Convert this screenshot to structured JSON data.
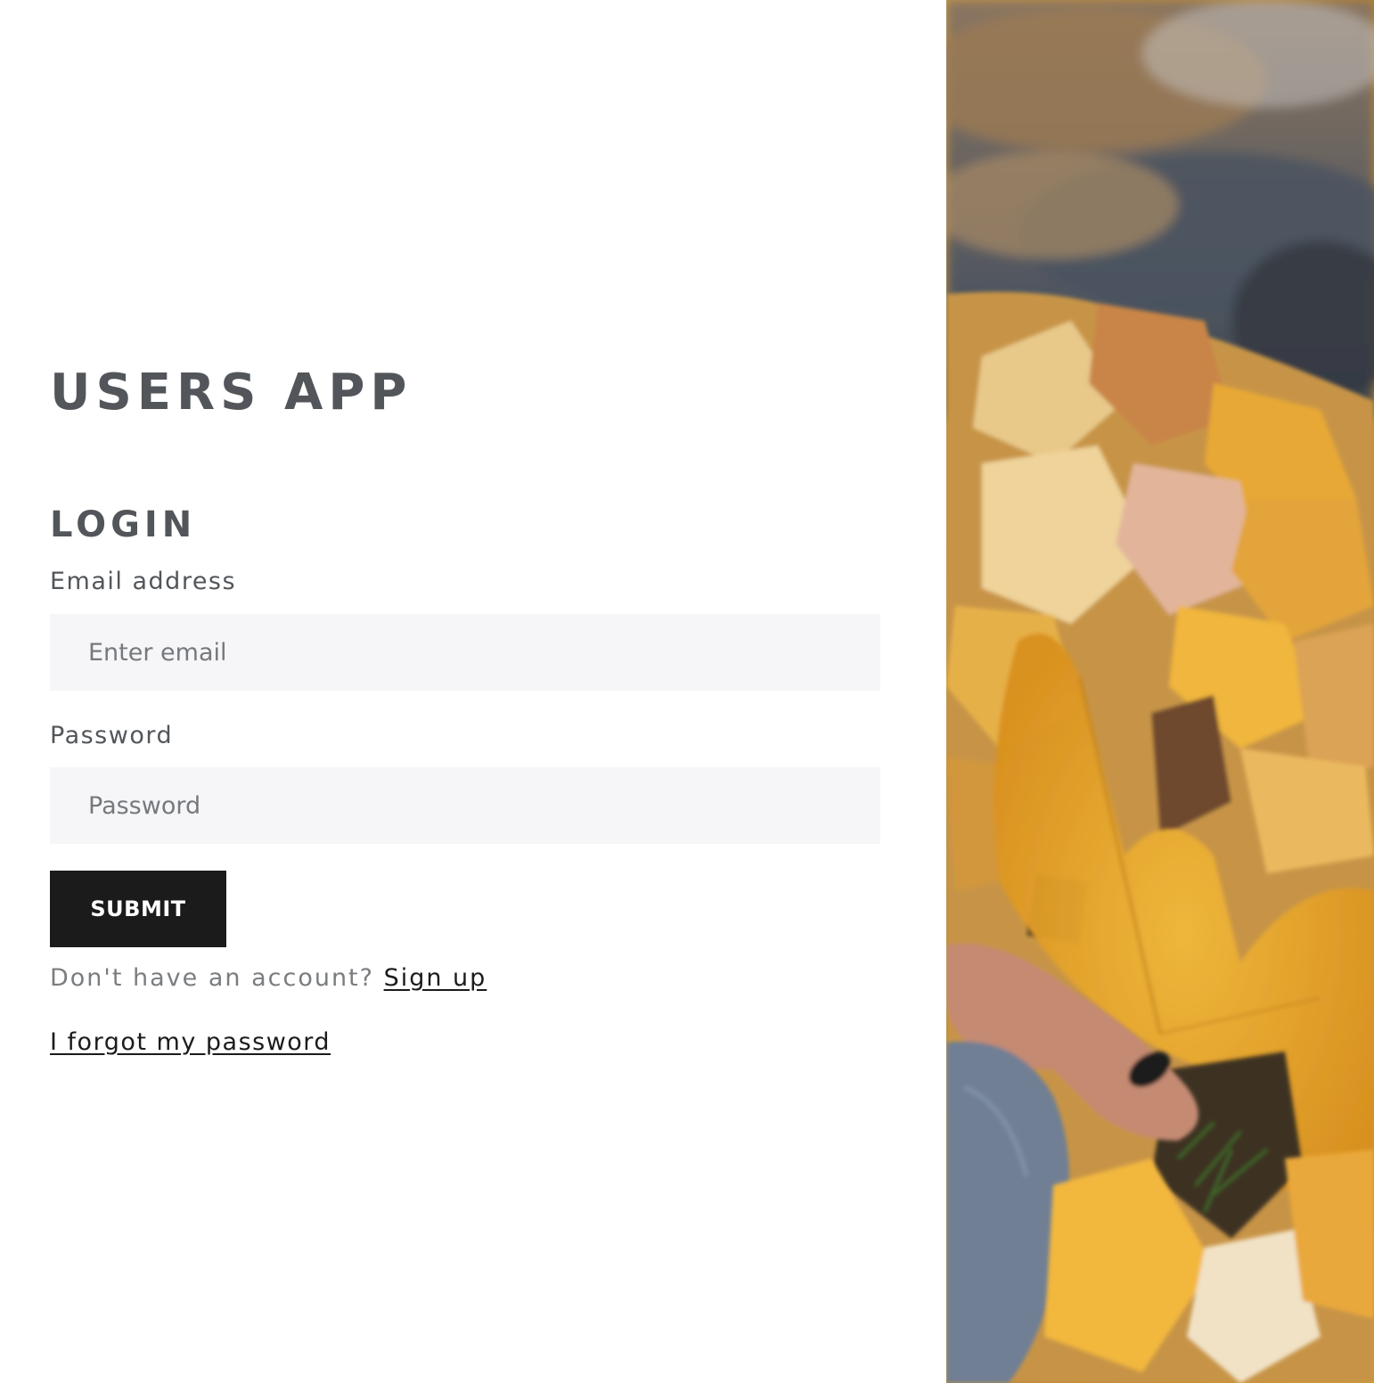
{
  "app": {
    "title": "USERS APP"
  },
  "login_form": {
    "heading": "LOGIN",
    "email": {
      "label": "Email address",
      "placeholder": "Enter email",
      "value": ""
    },
    "password": {
      "label": "Password",
      "placeholder": "Password",
      "value": ""
    },
    "submit_label": "SUBMIT"
  },
  "links": {
    "signup_prompt": "Don't have an account?",
    "signup_label": "Sign up",
    "forgot_password_label": "I forgot my password"
  },
  "hero_image": {
    "icon": "autumn-leaves-photo"
  },
  "colors": {
    "heading_text": "#52565a",
    "input_background": "#f6f6f8",
    "button_background": "#1b1b1b",
    "button_text": "#ffffff",
    "muted_text": "#7a7d80",
    "link_text": "#1b1b1b",
    "leaf_gold": "#e0a535"
  }
}
